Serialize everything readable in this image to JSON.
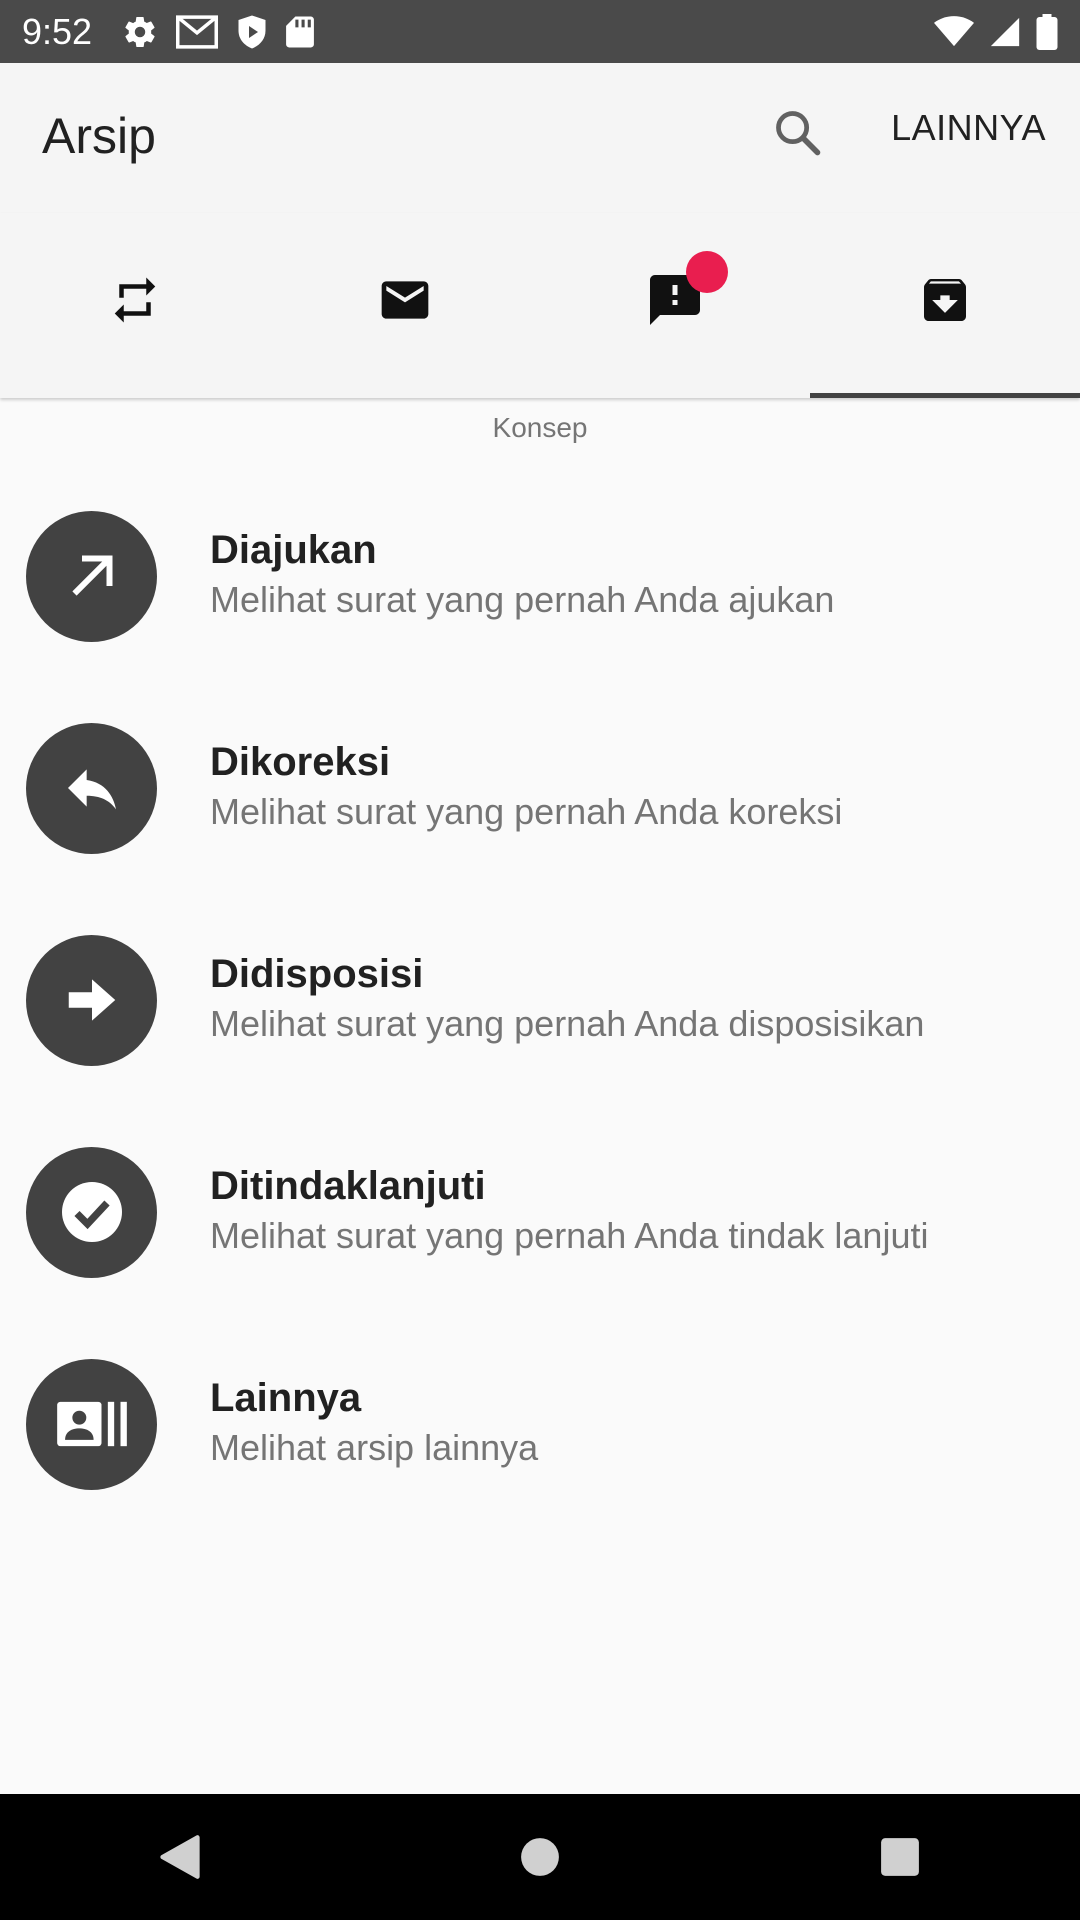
{
  "status_bar": {
    "time": "9:52"
  },
  "app_bar": {
    "title": "Arsip",
    "more_label": "LAINNYA"
  },
  "tabs": [
    {
      "icon": "repeat-icon",
      "active": false
    },
    {
      "icon": "mail-icon",
      "active": false
    },
    {
      "icon": "feedback-icon",
      "active": false,
      "badge": true
    },
    {
      "icon": "archive-icon",
      "active": true
    }
  ],
  "colors": {
    "badge": "#e91e4f",
    "avatar_bg": "#424242",
    "status_bar": "#4a4a4a"
  },
  "section_caption": "Konsep",
  "items": [
    {
      "icon": "arrow-up-right-icon",
      "title": "Diajukan",
      "subtitle": "Melihat surat yang pernah Anda ajukan"
    },
    {
      "icon": "reply-icon",
      "title": "Dikoreksi",
      "subtitle": "Melihat surat yang pernah Anda koreksi"
    },
    {
      "icon": "arrow-right-icon",
      "title": "Didisposisi",
      "subtitle": "Melihat surat yang pernah Anda disposisikan"
    },
    {
      "icon": "check-circle-icon",
      "title": "Ditindaklanjuti",
      "subtitle": "Melihat surat yang pernah Anda tindak lanjuti"
    },
    {
      "icon": "contacts-icon",
      "title": "Lainnya",
      "subtitle": "Melihat arsip lainnya"
    }
  ]
}
